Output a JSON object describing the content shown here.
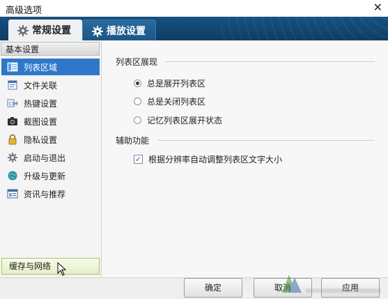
{
  "window": {
    "title": "高级选项",
    "close_glyph": "✕"
  },
  "tabs": [
    {
      "label": "常规设置",
      "icon": "gear-icon"
    },
    {
      "label": "播放设置",
      "icon": "gear-play-icon"
    }
  ],
  "sidebar": {
    "header": "基本设置",
    "items": [
      {
        "label": "列表区域",
        "icon": "list-panel-icon",
        "selected": true
      },
      {
        "label": "文件关联",
        "icon": "file-assoc-icon"
      },
      {
        "label": "热键设置",
        "icon": "hotkey-icon"
      },
      {
        "label": "截图设置",
        "icon": "camera-icon"
      },
      {
        "label": "隐私设置",
        "icon": "lock-icon"
      },
      {
        "label": "启动与退出",
        "icon": "startup-gear-icon"
      },
      {
        "label": "升级与更新",
        "icon": "globe-update-icon"
      },
      {
        "label": "资讯与推荐",
        "icon": "news-icon"
      }
    ],
    "footer": "缓存与网络"
  },
  "main": {
    "section1_title": "列表区展现",
    "radios": [
      {
        "label": "总是展开列表区",
        "checked": true
      },
      {
        "label": "总是关闭列表区",
        "checked": false
      },
      {
        "label": "记忆列表区展开状态",
        "checked": false
      }
    ],
    "section2_title": "辅助功能",
    "checkbox": {
      "label": "根据分辨率自动调整列表区文字大小",
      "checked": true
    }
  },
  "buttons": {
    "ok": "确定",
    "cancel": "取消",
    "apply": "应用"
  },
  "colors": {
    "header": "#17517f",
    "selected": "#2f78c9",
    "footer_highlight": "#e5f0c6"
  }
}
